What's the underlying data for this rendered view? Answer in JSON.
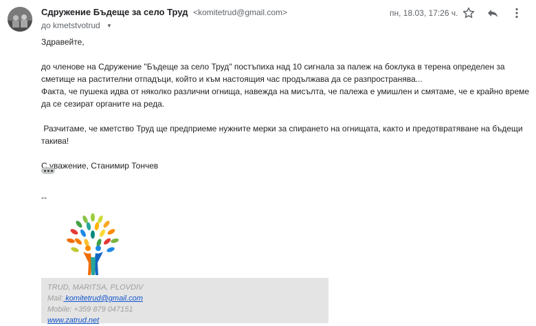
{
  "header": {
    "sender_name": "Сдружение Бъдеще за село Труд",
    "sender_email": "<komitetrud@gmail.com>",
    "recipient": "до kmetstvotrud",
    "date": "пн, 18.03, 17:26 ч."
  },
  "icons": {
    "avatar": "sender-avatar",
    "star": "star-icon",
    "reply": "reply-icon",
    "more": "more-vert-icon",
    "recipient_toggle": "chevron-down-icon"
  },
  "body": {
    "greeting": "Здравейте,",
    "para1": "до членове на Сдружение \"Бъдеще за село Труд\" постъпиха над 10 сигнала за палеж на боклука в терена определен за сметище на растителни отпадъци, който и към настоящия час продължава да се разпространява...",
    "para2": "Факта, че пушека идва от няколко различни огнища, навежда на мисълта, че палежа е умишлен и смятаме, че е крайно време да се сезират органите на реда.",
    "para3": " Разчитаме, че кметство Труд ще предприеме нужните мерки за спирането на огнищата, както и предотвратяване на бъдещи такива!",
    "closing": "С уважение, Станимир Тончев"
  },
  "signature": {
    "dash": "--",
    "location": "TRUD, MARITSA, PLOVDIV",
    "mail_label": "Mail:",
    "mail_value": " komitetrud@gmail.com",
    "mobile": "Mobile: +359 879 047151",
    "website": "www.zatrud.net"
  },
  "colors": {
    "link": "#1155cc",
    "signature_bg": "#e4e4e4",
    "signature_text": "#9e9e9e"
  }
}
